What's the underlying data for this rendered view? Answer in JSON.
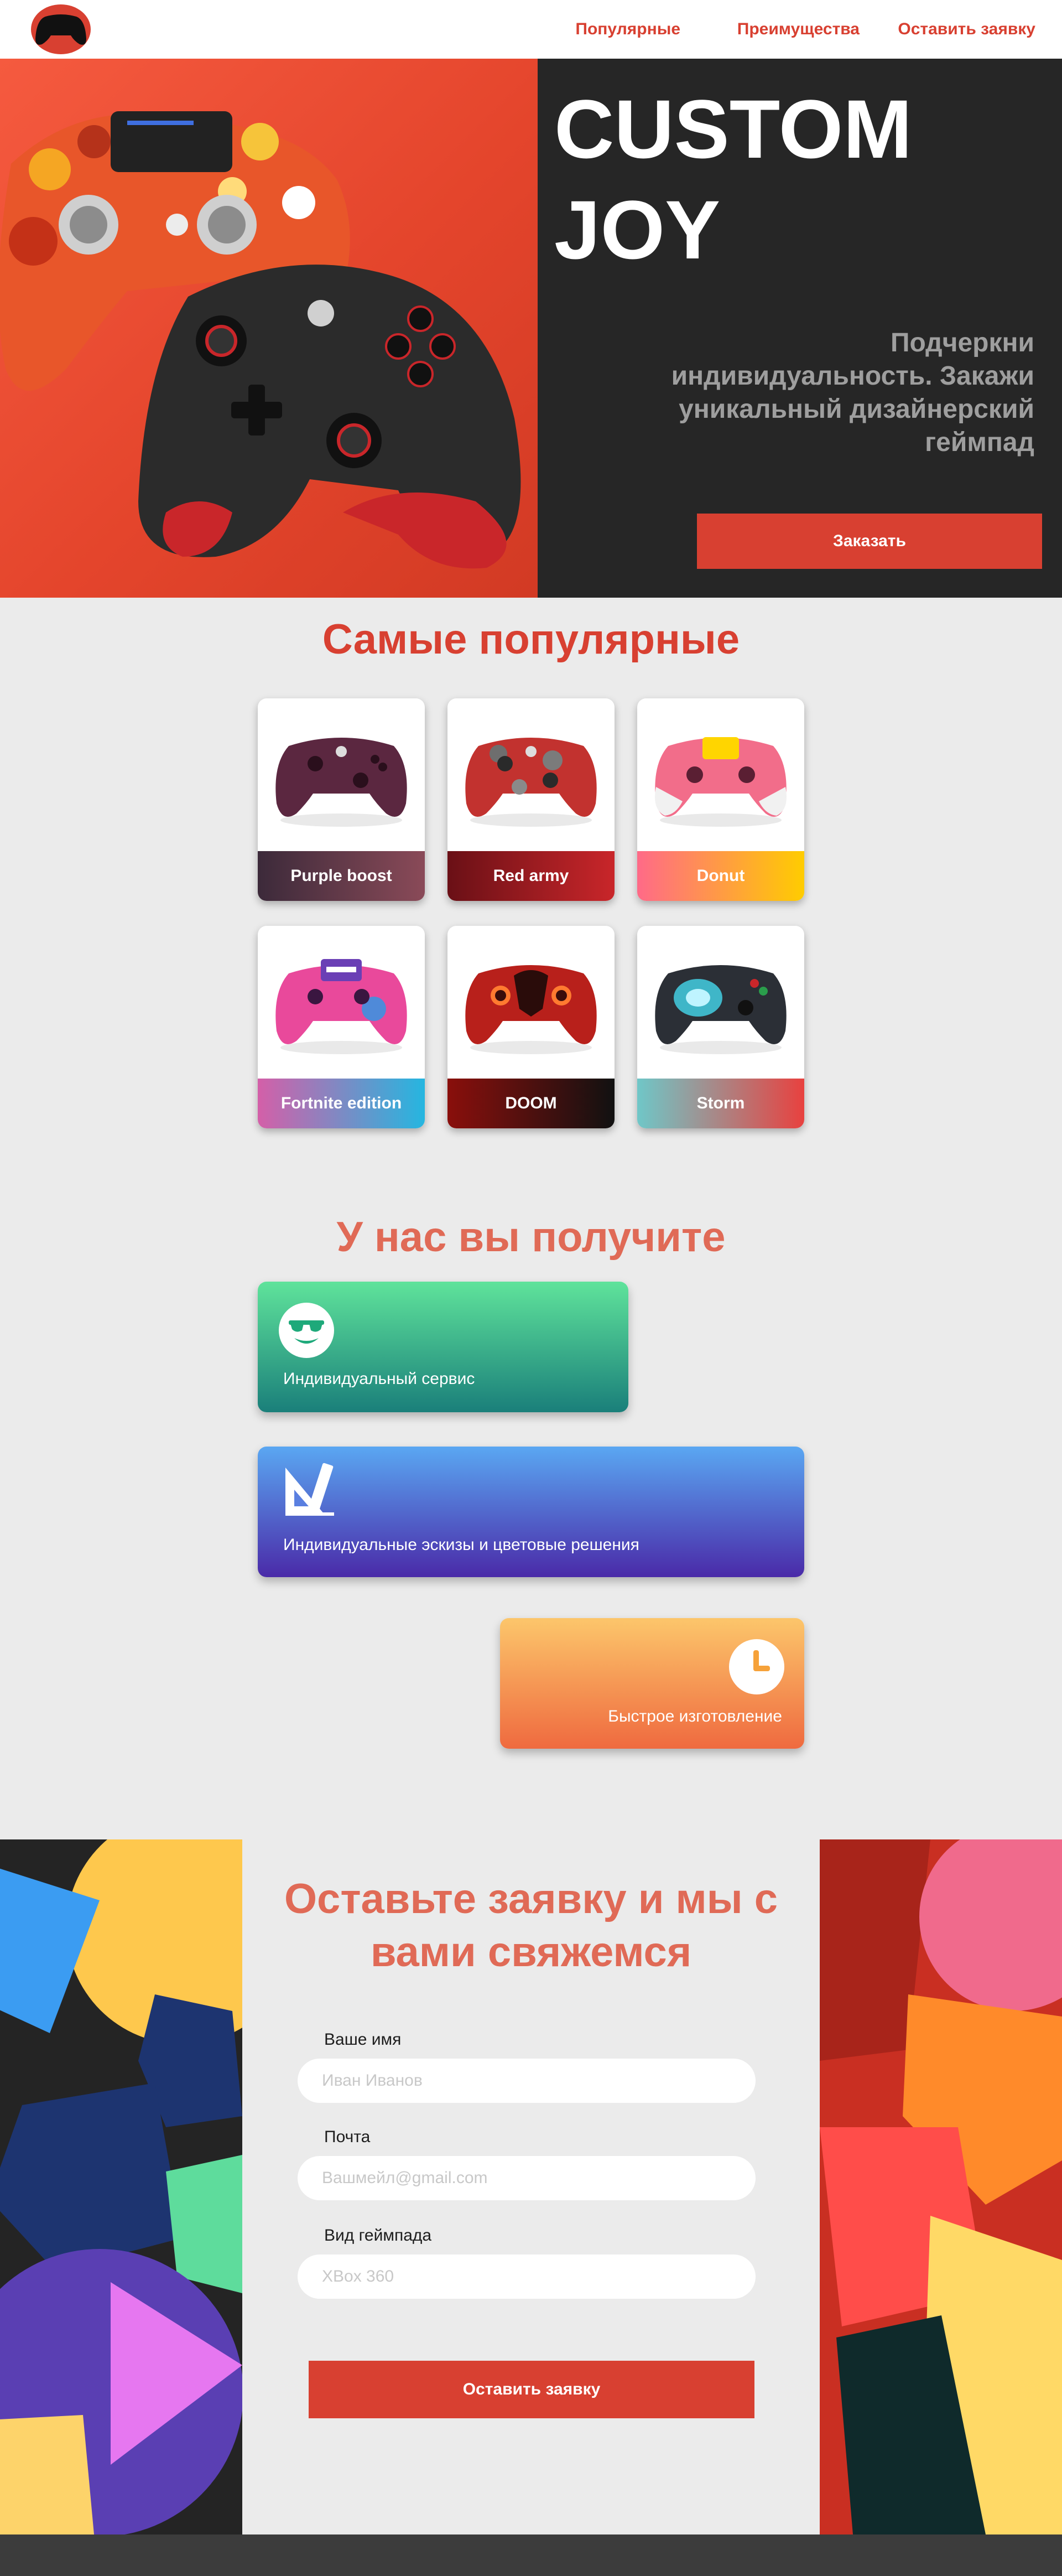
{
  "header": {
    "logo_icon": "gamepad-icon",
    "nav": [
      {
        "label": "Популярные"
      },
      {
        "label": "Преимущества"
      },
      {
        "label": "Оставить заявку"
      }
    ]
  },
  "hero": {
    "title": "CUSTOM JOY",
    "subtitle": "Подчеркни индивидуальность. Закажи уникальный дизайнерский геймпад",
    "order_button": "Заказать"
  },
  "popular": {
    "title": "Самые популярные",
    "items": [
      {
        "name": "Purple boost"
      },
      {
        "name": "Red army"
      },
      {
        "name": "Donut"
      },
      {
        "name": "Fortnite edition"
      },
      {
        "name": "DOOM"
      },
      {
        "name": "Storm"
      }
    ]
  },
  "benefits": {
    "title": "У нас вы получите",
    "items": [
      {
        "text": "Индивидуальный сервис",
        "icon": "smiley-sunglasses-icon"
      },
      {
        "text": "Индивидуальные эскизы и цветовые решения",
        "icon": "ruler-triangle-icon"
      },
      {
        "text": "Быстрое изготовление",
        "icon": "clock-icon"
      }
    ]
  },
  "form": {
    "title": "Оставьте заявку и мы с вами свяжемся",
    "name_label": "Ваше имя",
    "name_placeholder": "Иван Иванов",
    "email_label": "Почта",
    "email_placeholder": "Вашмейл@gmail.com",
    "gamepad_label": "Вид геймпада",
    "gamepad_placeholder": "XBox 360",
    "submit": "Оставить заявку"
  },
  "colors": {
    "accent": "#d84031",
    "dark": "#262626",
    "background": "#ebebeb",
    "subtitle_gray": "#9e9e9e",
    "section_title": "#e06a56"
  }
}
